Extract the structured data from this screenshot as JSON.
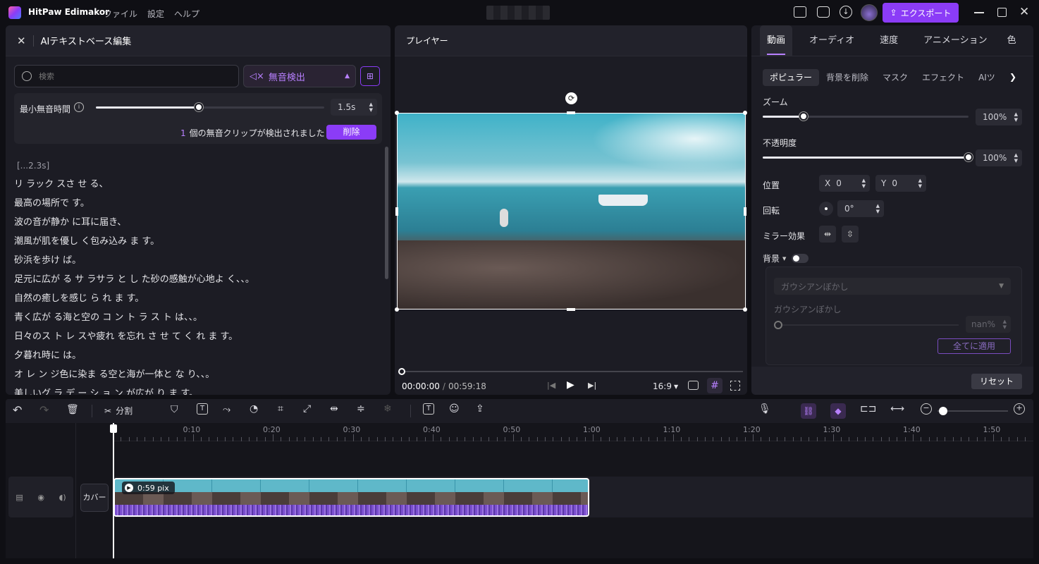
{
  "app": {
    "name": "HitPaw Edimakor",
    "menu": [
      "ファイル",
      "設定",
      "ヘルプ"
    ],
    "export_label": "エクスポート",
    "window_controls": [
      "minimize-icon",
      "maximize-icon",
      "close-icon"
    ]
  },
  "left_panel": {
    "title": "AIテキストベース編集",
    "search_placeholder": "検索",
    "mode_label": "無音検出",
    "min_silence_label": "最小無音時間",
    "min_silence_value": "1.5s",
    "min_silence_slider": 0.45,
    "detect_count": "1",
    "detect_text": "個の無音クリップが検出されました",
    "delete_label": "削除",
    "silence_marker": "[...2.3s]",
    "transcript": [
      "リ ラック スさ せ る、",
      "最高の場所で す。",
      "波の音が静か に耳に届き、",
      "潮風が肌を優し く包み込み ま す。",
      "砂浜を歩け ば。",
      "足元に広が る サ ラサラ と し た砂の感触が心地よ く、、。",
      "自然の癒しを感じ ら れ ま す。",
      "青く広が る海と空の コ ン ト ラ ス ト は、、。",
      "日々のス ト レ スや疲れ を忘れ さ せ て く れ ま す。",
      "夕暮れ時に は。",
      "オ レ ン ジ色に染ま る空と海が一体と な り、、。",
      "美しいグ ラ デ ー シ ョ ン が広が り ま す。"
    ]
  },
  "player": {
    "title": "プレイヤー",
    "current_time": "00:00:00",
    "separator": "/",
    "total_time": "00:59:18",
    "aspect": "16:9",
    "progress": 0.0
  },
  "right_panel": {
    "tabs": [
      "動画",
      "オーディオ",
      "速度",
      "アニメーション",
      "色"
    ],
    "active_tab": "動画",
    "subtabs": [
      "ポピュラー",
      "背景を削除",
      "マスク",
      "エフェクト",
      "AIツ"
    ],
    "zoom_label": "ズーム",
    "zoom_value": "100%",
    "zoom_slider": 0.2,
    "opacity_label": "不透明度",
    "opacity_value": "100%",
    "opacity_slider": 1.0,
    "position_label": "位置",
    "pos_x_label": "X",
    "pos_x": "0",
    "pos_y_label": "Y",
    "pos_y": "0",
    "rotation_label": "回転",
    "rotation_value": "0°",
    "mirror_label": "ミラー効果",
    "background_label": "背景",
    "blur_select": "ガウシアンぼかし",
    "blur_label": "ガウシアンぼかし",
    "blur_value": "nan%",
    "apply_all": "全てに適用",
    "reset": "リセット"
  },
  "toolbar": {
    "split_label": "分割"
  },
  "timeline": {
    "ticks": [
      "0:10",
      "0:20",
      "0:30",
      "0:40",
      "0:50",
      "1:00",
      "1:10",
      "1:20",
      "1:30",
      "1:40",
      "1:50"
    ],
    "clip_label": "0:59 pix",
    "cover_label": "カバー"
  }
}
